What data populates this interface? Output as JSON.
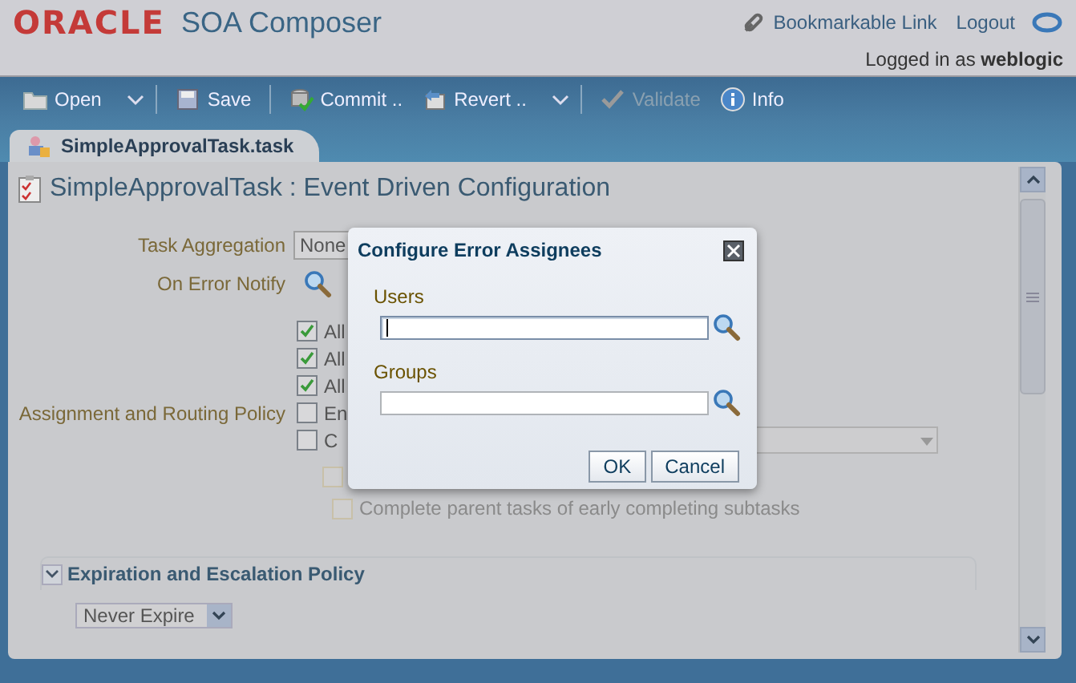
{
  "header": {
    "logo": "ORACLE",
    "product": "SOA Composer",
    "links": [
      {
        "label": "Bookmarkable Link",
        "kind": "with-icon"
      },
      {
        "label": "Logout",
        "kind": "plain"
      }
    ],
    "login_text": "Logged in as **weblogic**"
  },
  "toolbar": [
    {
      "label": "Open",
      "kind": "folder",
      "menu": true,
      "disabled": false
    },
    {
      "label": "Save",
      "kind": "save",
      "menu": false,
      "disabled": false
    },
    {
      "label": "Commit ..",
      "kind": "commit",
      "menu": false,
      "disabled": false
    },
    {
      "label": "Revert ..",
      "kind": "revert",
      "menu": true,
      "disabled": false
    },
    {
      "label": "Validate",
      "kind": "check",
      "menu": false,
      "disabled": true
    },
    {
      "label": "Info",
      "kind": "info",
      "menu": false,
      "disabled": false
    }
  ],
  "tabs": [
    {
      "label": "SimpleApprovalTask.task",
      "selected": true
    }
  ],
  "panel": {
    "title": "SimpleApprovalTask : Event Driven Configuration",
    "task_aggregation": {
      "label": "Task Aggregation",
      "value": "None"
    },
    "on_error_notify": {
      "label": "On Error Notify"
    },
    "routing": {
      "label": "Assignment and Routing Policy",
      "options": [
        {
          "label": "All",
          "checked": true,
          "disabled": false
        },
        {
          "label": "All",
          "checked": true,
          "disabled": false
        },
        {
          "label": "All",
          "checked": true,
          "disabled": false
        },
        {
          "label": "En",
          "checked": false,
          "disabled": false
        },
        {
          "label": "C",
          "checked": false,
          "disabled": false,
          "kind": "with-select"
        }
      ],
      "sub_options": [
        {
          "checked": false,
          "disabled": true
        },
        {
          "label": "Complete parent tasks of early completing subtasks",
          "checked": false,
          "disabled": true
        }
      ]
    },
    "section": {
      "title": "Expiration and Escalation Policy",
      "expanded": true,
      "select": "Never Expire"
    }
  },
  "dialog": {
    "title": "Configure Error Assignees",
    "fields": [
      {
        "label": "Users",
        "focused": true
      },
      {
        "label": "Groups",
        "focused": false
      }
    ],
    "buttons": [
      "OK",
      "Cancel"
    ]
  }
}
